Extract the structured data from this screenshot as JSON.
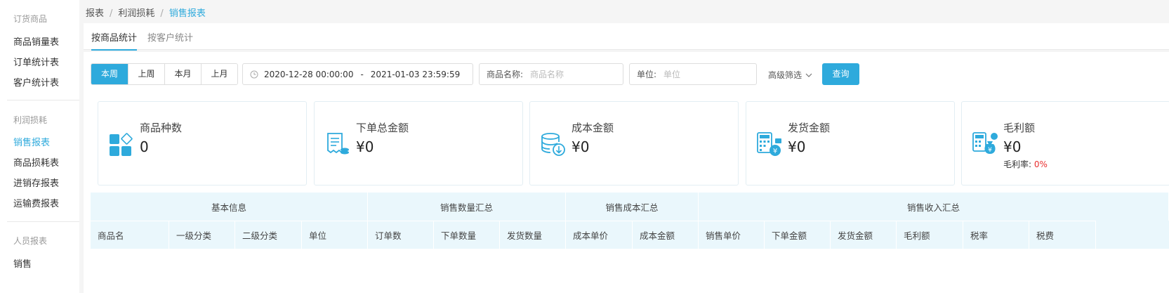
{
  "sidebar": {
    "groups": [
      {
        "title": "订货商品",
        "items": [
          "商品销量表",
          "订单统计表",
          "客户统计表"
        ]
      },
      {
        "title": "利润损耗",
        "items": [
          "销售报表",
          "商品损耗表",
          "进销存报表",
          "运输费报表"
        ]
      },
      {
        "title": "人员报表",
        "items": [
          "销售"
        ]
      }
    ]
  },
  "breadcrumb": [
    "报表",
    "利润损耗",
    "销售报表"
  ],
  "tabs": [
    "按商品统计",
    "按客户统计"
  ],
  "period_buttons": [
    "本周",
    "上周",
    "本月",
    "上月"
  ],
  "date_range": {
    "start": "2020-12-28 00:00:00",
    "separator": "-",
    "end": "2021-01-03 23:59:59"
  },
  "product_name_field": {
    "label": "商品名称:",
    "placeholder": "商品名称"
  },
  "unit_field": {
    "label": "单位:",
    "placeholder": "单位"
  },
  "advanced_filter": "高级筛选",
  "query_button": "查询",
  "stats": [
    {
      "title": "商品种数",
      "value": "0",
      "icon": "grid-shapes-icon"
    },
    {
      "title": "下单总金额",
      "value": "¥0",
      "icon": "receipt-icon"
    },
    {
      "title": "成本金额",
      "value": "¥0",
      "icon": "database-download-icon"
    },
    {
      "title": "发货金额",
      "value": "¥0",
      "icon": "calculator-yen-icon"
    },
    {
      "title": "毛利额",
      "value": "¥0",
      "icon": "calculator-moneybag-icon",
      "sub_label": "毛利率:",
      "sub_value": "0%"
    }
  ],
  "table": {
    "groups": [
      "基本信息",
      "销售数量汇总",
      "销售成本汇总",
      "销售收入汇总"
    ],
    "columns": [
      "商品名",
      "一级分类",
      "二级分类",
      "单位",
      "订单数",
      "下单数量",
      "发货数量",
      "成本单价",
      "成本金额",
      "销售单价",
      "下单金额",
      "发货金额",
      "毛利额",
      "税率",
      "税费"
    ]
  },
  "colors": {
    "accent": "#2eaadc",
    "danger": "#e93030",
    "header_bg": "#eaf7fc"
  }
}
